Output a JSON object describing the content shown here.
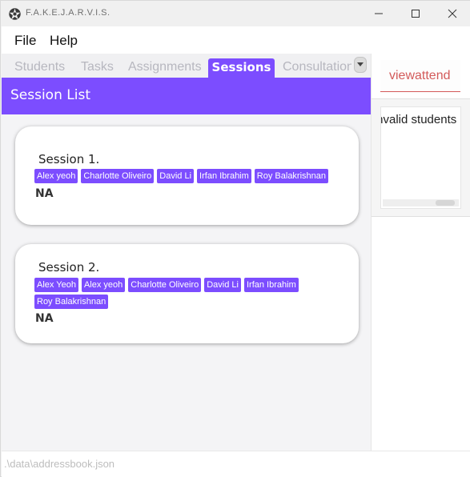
{
  "window": {
    "title": "F.A.K.E.J.A.R.V.I.S.",
    "icons": [
      "app-logo-icon",
      "minimize-icon",
      "maximize-icon",
      "close-icon"
    ]
  },
  "menu": {
    "file_label": "File",
    "help_label": "Help"
  },
  "tabs": {
    "items": [
      {
        "label": "Students",
        "selected": false
      },
      {
        "label": "Tasks",
        "selected": false
      },
      {
        "label": "Assignments",
        "selected": false
      },
      {
        "label": "Sessions",
        "selected": true
      },
      {
        "label": "Consultations",
        "selected": false
      }
    ],
    "overflow_icon": "chevron-down-icon"
  },
  "session_list": {
    "title": "Session List",
    "sessions": [
      {
        "title": "Session 1.",
        "students": [
          "Alex yeoh",
          "Charlotte Oliveiro",
          "David Li",
          "Irfan Ibrahim",
          "Roy Balakrishnan"
        ],
        "status": "NA"
      },
      {
        "title": "Session 2.",
        "students": [
          "Alex Yeoh",
          "Alex yeoh",
          "Charlotte Oliveiro",
          "David Li",
          "Irfan Ibrahim",
          "Roy Balakrishnan"
        ],
        "status": "NA"
      }
    ]
  },
  "command": {
    "value": "viewattend"
  },
  "result": {
    "text": "Invalid students"
  },
  "status_bar": {
    "path": ".\\data\\addressbook.json"
  },
  "colors": {
    "accent": "#7c4dff",
    "command_text": "#d35a5a"
  }
}
